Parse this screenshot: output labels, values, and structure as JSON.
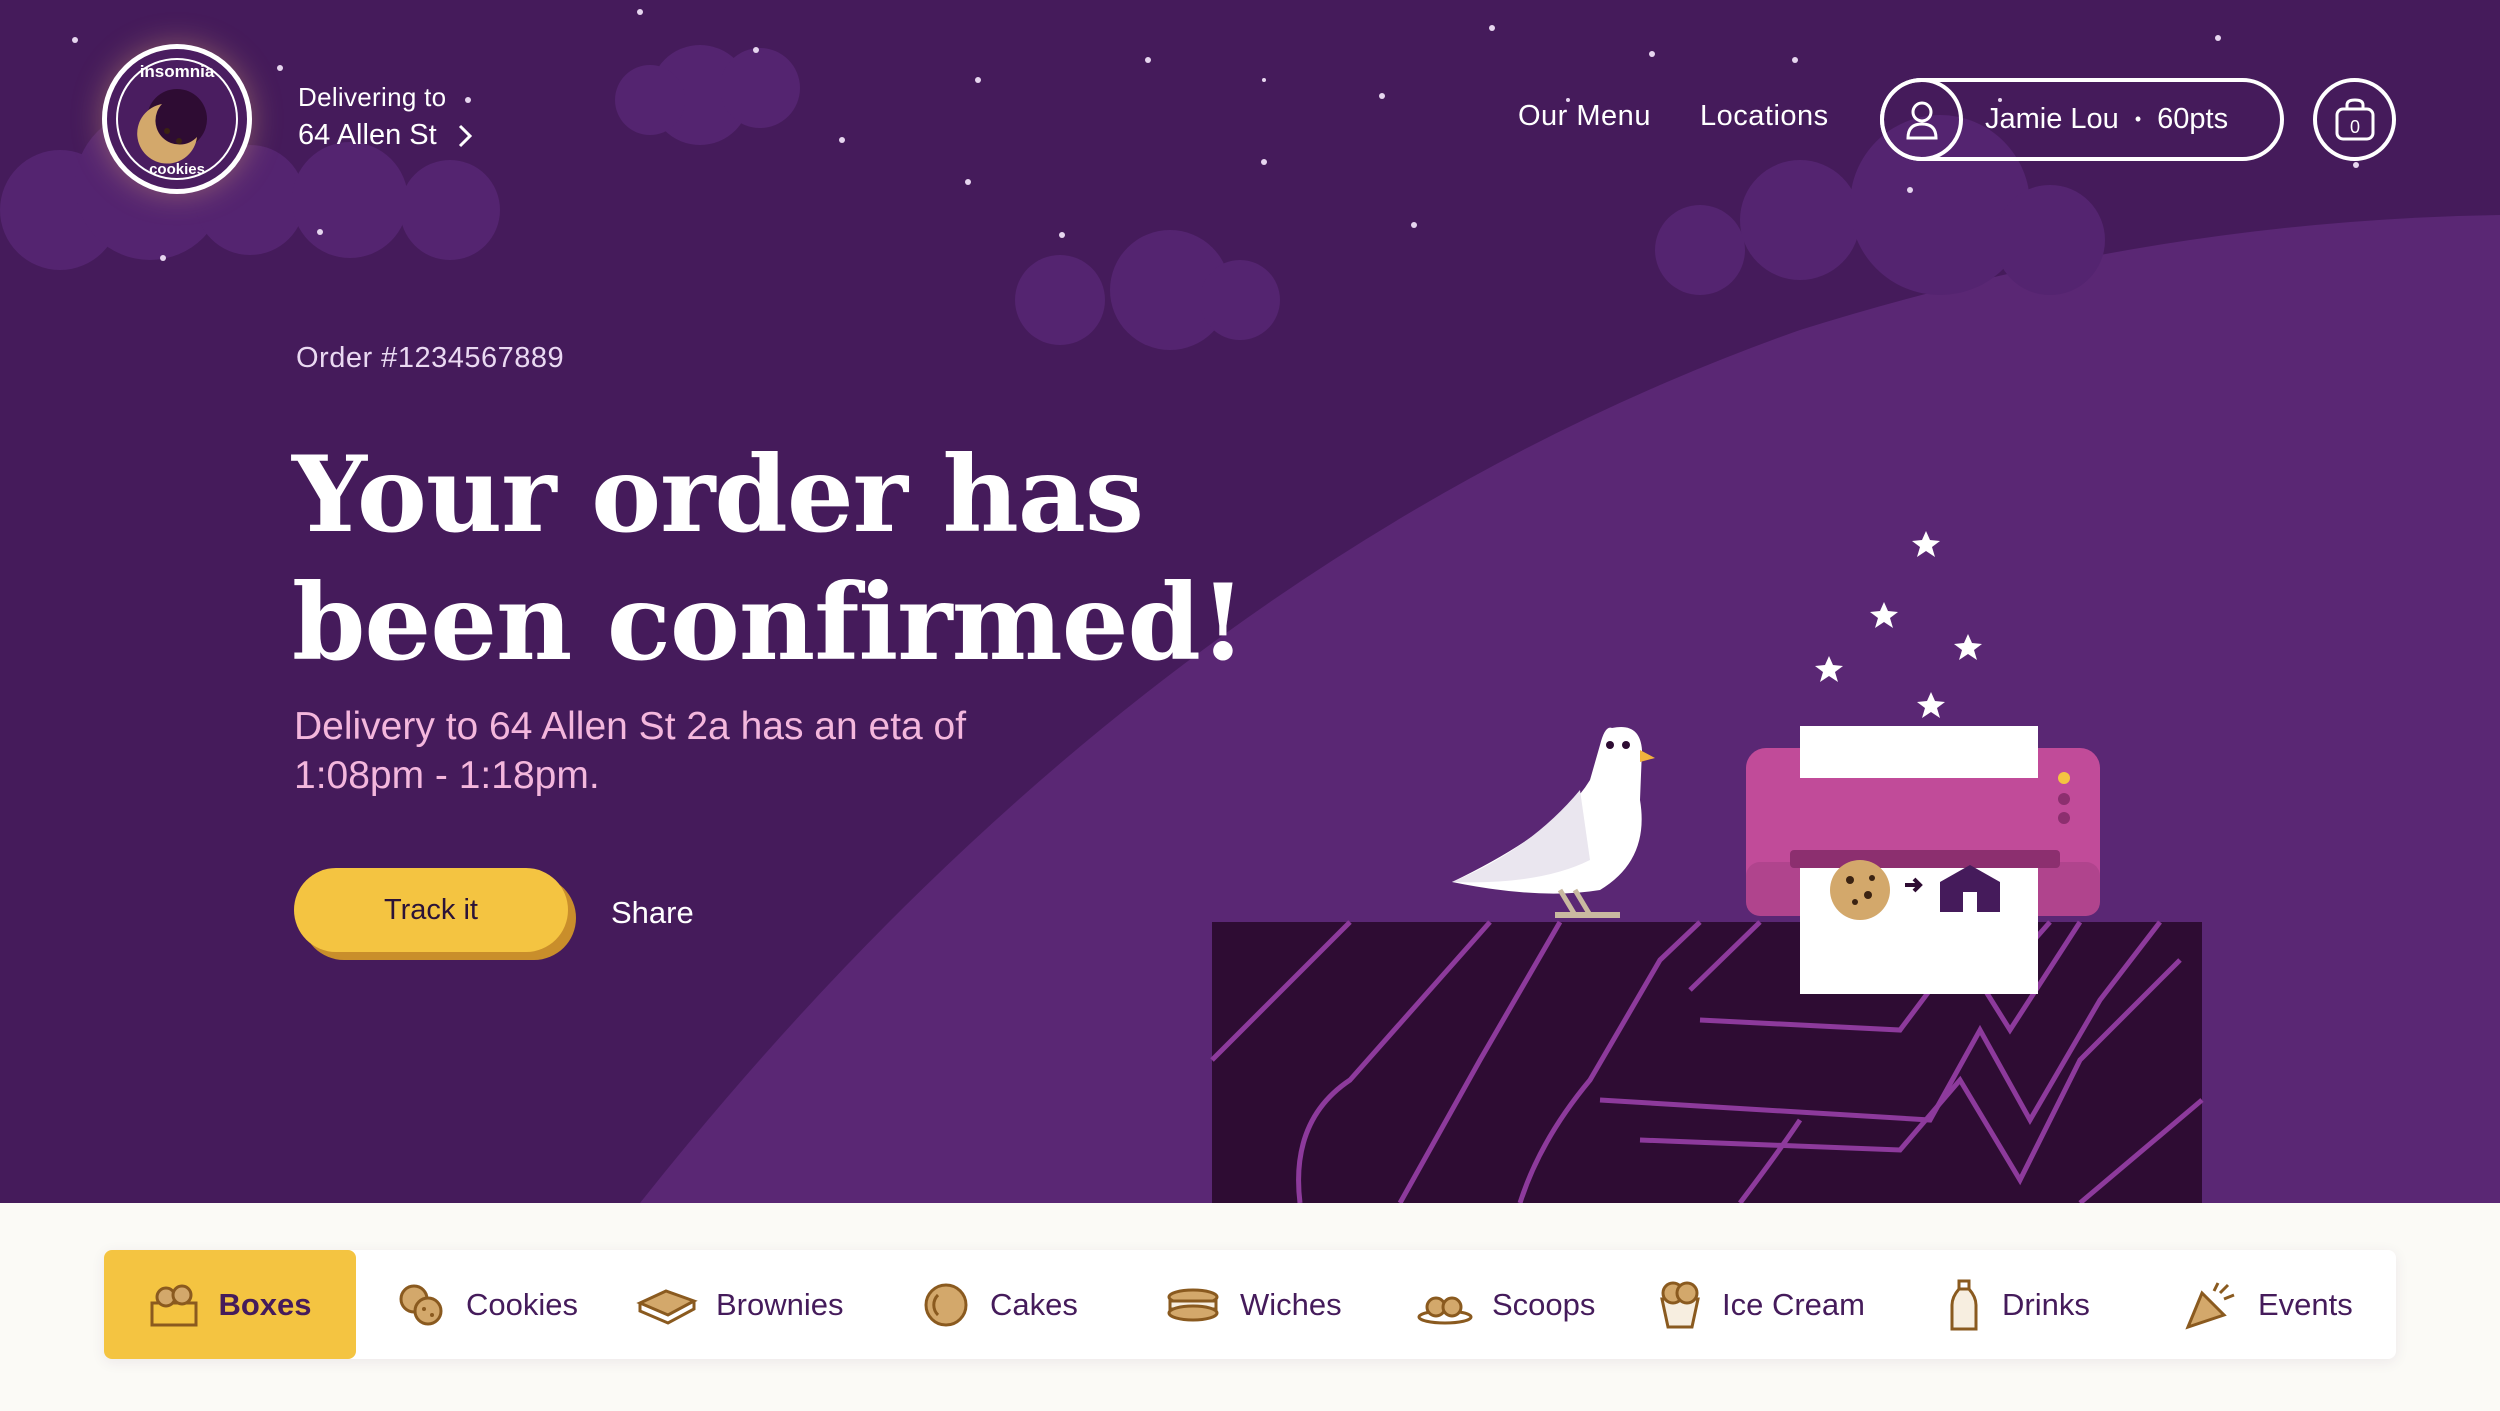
{
  "header": {
    "delivering_label": "Delivering to",
    "address": "64 Allen St",
    "nav": [
      "Our Menu",
      "Locations"
    ],
    "user_name": "Jamie Lou",
    "points": "60pts",
    "cart_count": "0"
  },
  "hero": {
    "order_number": "Order #1234567889",
    "headline_line1": "Your order has",
    "headline_line2": "been confirmed!",
    "eta_text": "Delivery to 64 Allen St 2a has an eta of 1:08pm - 1:18pm.",
    "track_label": "Track it",
    "share_label": "Share"
  },
  "categories": [
    {
      "label": "Boxes",
      "icon": "box-icon",
      "active": true
    },
    {
      "label": "Cookies",
      "icon": "cookies-icon",
      "active": false
    },
    {
      "label": "Brownies",
      "icon": "brownie-icon",
      "active": false
    },
    {
      "label": "Cakes",
      "icon": "cake-icon",
      "active": false
    },
    {
      "label": "Wiches",
      "icon": "sandwich-icon",
      "active": false
    },
    {
      "label": "Scoops",
      "icon": "scoops-icon",
      "active": false
    },
    {
      "label": "Ice Cream",
      "icon": "ice-cream-icon",
      "active": false
    },
    {
      "label": "Drinks",
      "icon": "bottle-icon",
      "active": false
    },
    {
      "label": "Events",
      "icon": "party-popper-icon",
      "active": false
    }
  ],
  "colors": {
    "hero_bg": "#451b5b",
    "accent_yellow": "#f4c441",
    "eta_pink": "#f4b7dd",
    "machine_magenta": "#c14b99",
    "ground_dark": "#2e0c33"
  }
}
